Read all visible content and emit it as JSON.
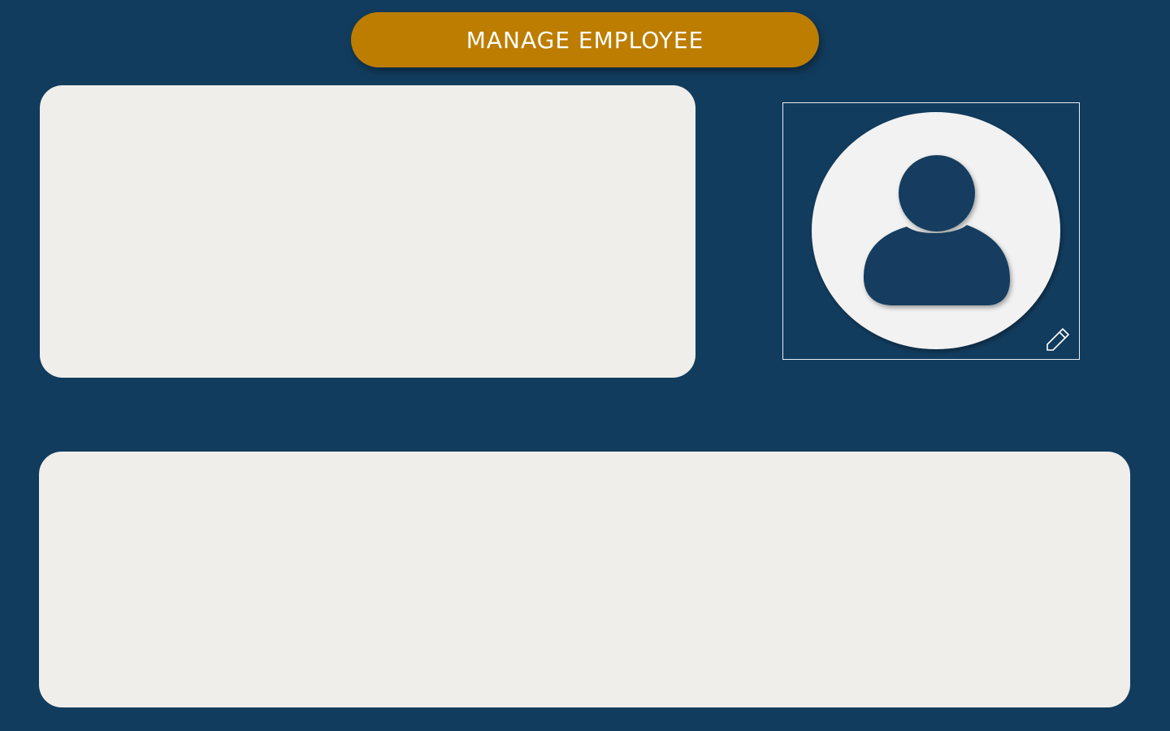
{
  "header": {
    "title": "Manage Employee"
  },
  "colors": {
    "background": "#123c5e",
    "title_pill": "#bd7d00",
    "panel": "#f0eeea",
    "avatar": "#f2f2f2"
  },
  "profile_photo": {
    "placeholder_icon": "user-silhouette-icon",
    "edit_icon": "pencil-icon"
  }
}
